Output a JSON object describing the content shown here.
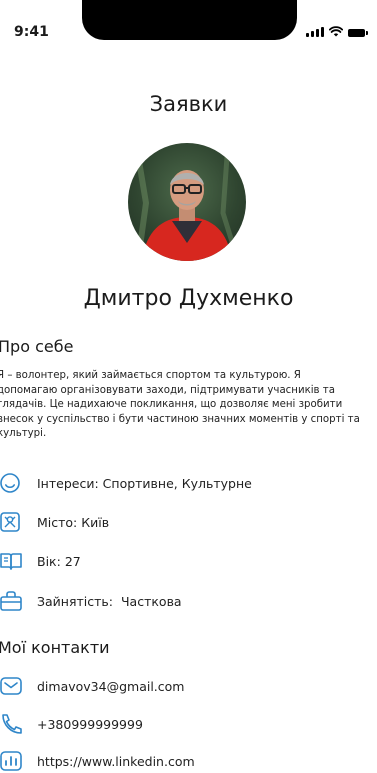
{
  "status_bar": {
    "time": "9:41"
  },
  "header": {
    "title": "Заявки"
  },
  "profile": {
    "name": "Дмитро Духменко"
  },
  "about": {
    "title": "Про себе",
    "text": "Я – волонтер, який займається спортом та культурою. Я допомагаю організовувати заходи, підтримувати учасників та глядачів. Це надихаюче покликання, що дозволяє мені зробити внесок у суспільство і бути частиною значних моментів у спорті та культурі."
  },
  "info": {
    "interests": {
      "label": "Інтереси:",
      "value": "Спортивне, Культурне",
      "icon": "smile-icon"
    },
    "city": {
      "label": "Місто:",
      "value": "Київ",
      "icon": "map-icon"
    },
    "age": {
      "label": "Вік:",
      "value": "27",
      "icon": "book-icon"
    },
    "employment": {
      "label": "Зайнятість:",
      "value": "Часткова",
      "icon": "bag-icon"
    }
  },
  "contacts": {
    "title": "Мої контакти",
    "email": {
      "value": "dimavov34@gmail.com",
      "icon": "mail-icon"
    },
    "phone": {
      "value": "+380999999999",
      "icon": "phone-icon"
    },
    "linkedin": {
      "value": "https://www.linkedin.com",
      "icon": "chart-icon"
    }
  },
  "colors": {
    "accent": "#2f86c9"
  }
}
